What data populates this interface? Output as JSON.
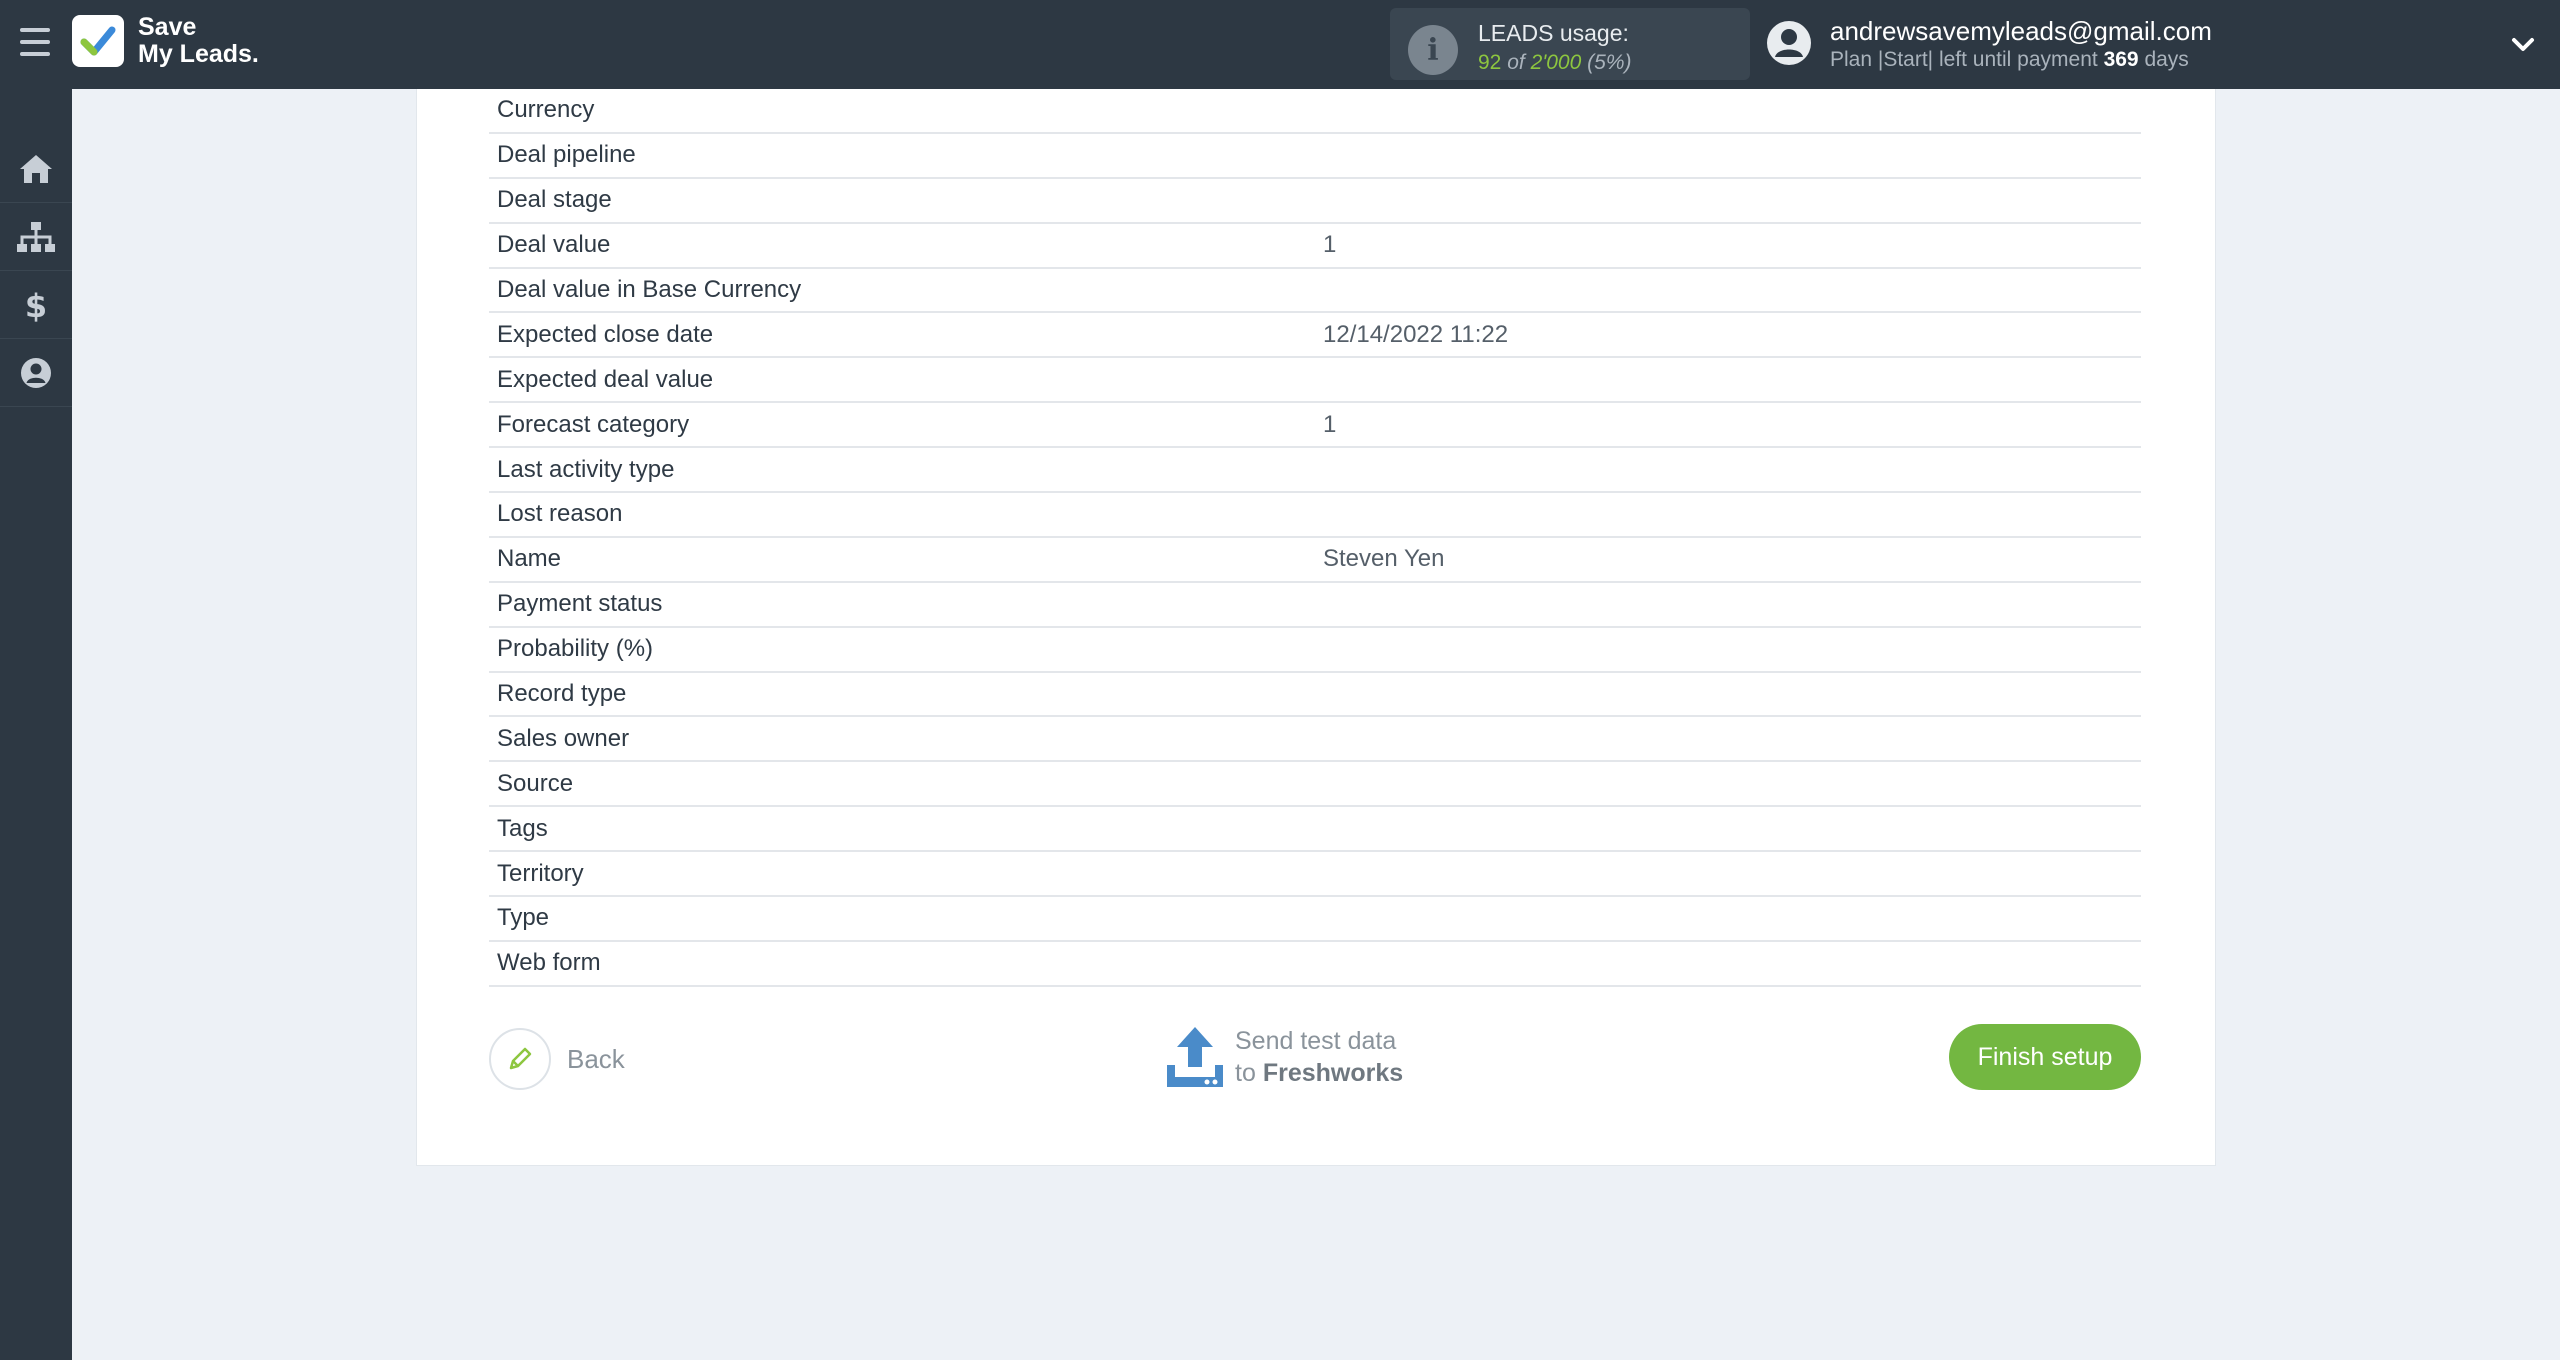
{
  "header": {
    "logo_line1": "Save",
    "logo_line2": "My Leads.",
    "usage_title": "LEADS usage:",
    "usage_used": "92",
    "usage_of": "of",
    "usage_total": "2'000",
    "usage_percent": "(5%)",
    "account_email": "andrewsavemyleads@gmail.com",
    "plan_prefix": "Plan |Start| left until payment",
    "plan_days": "369",
    "plan_suffix": "days"
  },
  "sidebar": {
    "items": [
      {
        "name": "home-icon"
      },
      {
        "name": "sitemap-icon"
      },
      {
        "name": "dollar-icon"
      },
      {
        "name": "user-circle-icon"
      }
    ]
  },
  "fields": [
    {
      "label": "Currency",
      "value": ""
    },
    {
      "label": "Deal pipeline",
      "value": ""
    },
    {
      "label": "Deal stage",
      "value": ""
    },
    {
      "label": "Deal value",
      "value": "1"
    },
    {
      "label": "Deal value in Base Currency",
      "value": ""
    },
    {
      "label": "Expected close date",
      "value": "12/14/2022 11:22"
    },
    {
      "label": "Expected deal value",
      "value": ""
    },
    {
      "label": "Forecast category",
      "value": "1"
    },
    {
      "label": "Last activity type",
      "value": ""
    },
    {
      "label": "Lost reason",
      "value": ""
    },
    {
      "label": "Name",
      "value": "Steven Yen"
    },
    {
      "label": "Payment status",
      "value": ""
    },
    {
      "label": "Probability (%)",
      "value": ""
    },
    {
      "label": "Record type",
      "value": ""
    },
    {
      "label": "Sales owner",
      "value": ""
    },
    {
      "label": "Source",
      "value": ""
    },
    {
      "label": "Tags",
      "value": ""
    },
    {
      "label": "Territory",
      "value": ""
    },
    {
      "label": "Type",
      "value": ""
    },
    {
      "label": "Web form",
      "value": ""
    }
  ],
  "footer": {
    "back_label": "Back",
    "send_line1": "Send test data",
    "send_to": "to",
    "send_target": "Freshworks",
    "finish_label": "Finish setup"
  },
  "colors": {
    "topbar": "#2d3843",
    "accent_green": "#73b741",
    "usage_green": "#8dc63f",
    "upload_blue": "#4a8bc9"
  }
}
